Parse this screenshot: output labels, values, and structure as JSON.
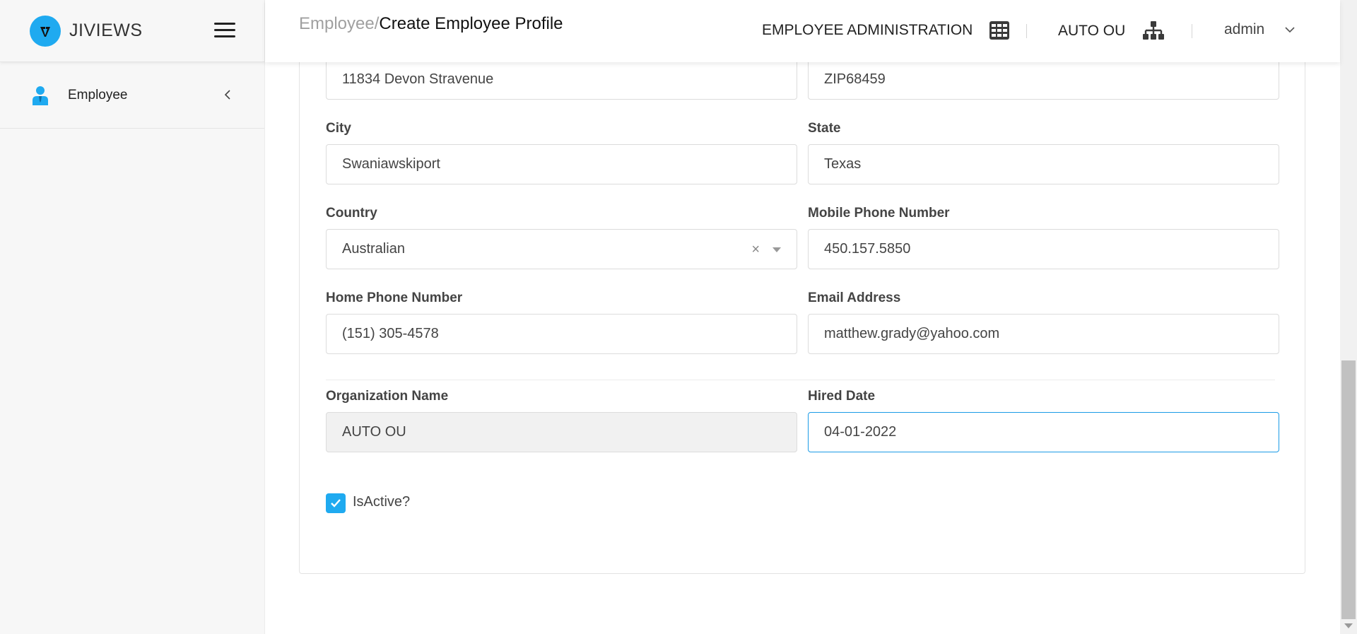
{
  "brand": {
    "name": "JIVIEWS",
    "logo_icon": "v-logo-icon",
    "accent": "#1faaf0"
  },
  "sidebar": {
    "items": [
      {
        "label": "Employee",
        "icon": "user-icon"
      }
    ]
  },
  "header": {
    "breadcrumb_parent": "Employee/",
    "breadcrumb_current": "Create Employee Profile",
    "module": "EMPLOYEE ADMINISTRATION",
    "org_unit": "AUTO OU",
    "user": "admin"
  },
  "form": {
    "address": {
      "value": "11834 Devon Stravenue"
    },
    "zip": {
      "value": "ZIP68459"
    },
    "city": {
      "label": "City",
      "value": "Swaniawskiport"
    },
    "state": {
      "label": "State",
      "value": "Texas"
    },
    "country": {
      "label": "Country",
      "value": "Australian",
      "clear": "×"
    },
    "mobile_phone": {
      "label": "Mobile Phone Number",
      "value": "450.157.5850"
    },
    "home_phone": {
      "label": "Home Phone Number",
      "value": "(151) 305-4578"
    },
    "email": {
      "label": "Email Address",
      "value": "matthew.grady@yahoo.com"
    },
    "organization": {
      "label": "Organization Name",
      "value": "AUTO OU"
    },
    "hired_date": {
      "label": "Hired Date",
      "value": "04-01-2022"
    },
    "is_active": {
      "label": "IsActive?",
      "checked": true
    }
  }
}
